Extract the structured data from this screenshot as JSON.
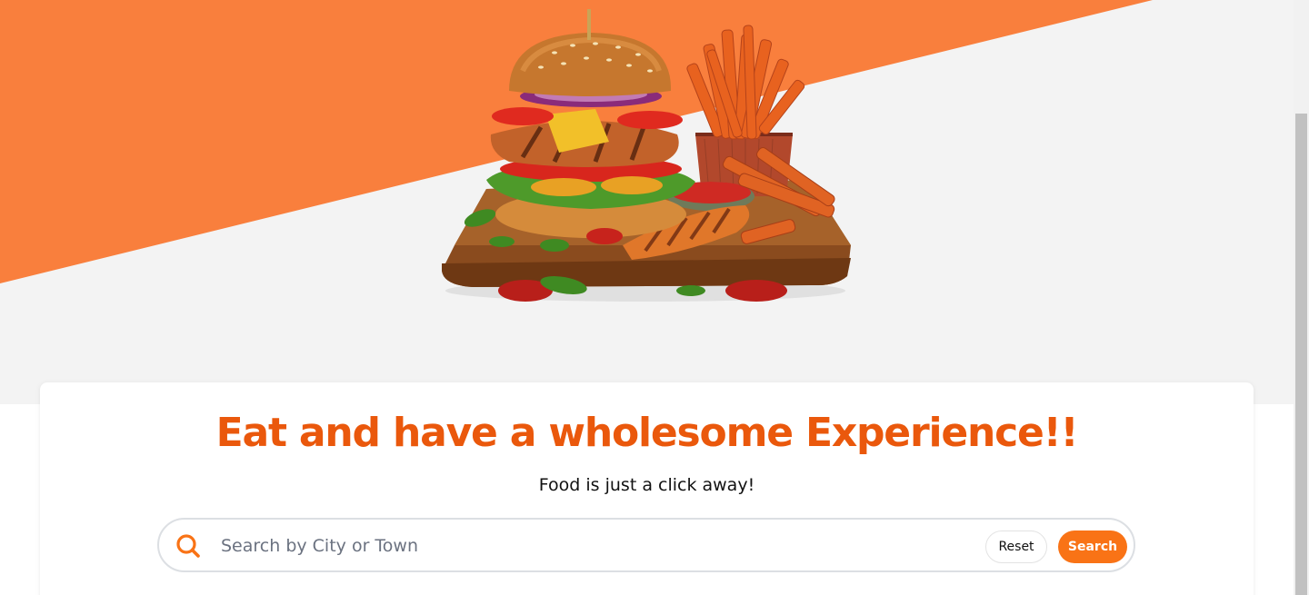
{
  "hero": {
    "accent_color": "#f97f3d",
    "background_color": "#f3f3f3",
    "image": "burger-and-sweet-potato-fries-illustration"
  },
  "main": {
    "headline": "Eat and have a wholesome Experience!!",
    "subheadline": "Food is just a click away!"
  },
  "search": {
    "icon": "search-icon",
    "placeholder": "Search by City or Town",
    "value": "",
    "reset_label": "Reset",
    "search_label": "Search",
    "brand_color": "#f97316"
  }
}
